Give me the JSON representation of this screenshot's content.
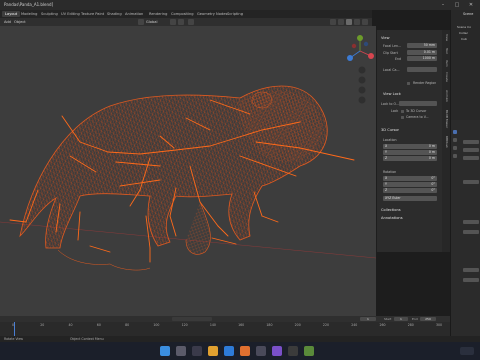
{
  "window": {
    "title": "Pandas\\Panda_A1.blend]"
  },
  "workspace_tabs": [
    {
      "label": "Layout",
      "active": true
    },
    {
      "label": "Modeling"
    },
    {
      "label": "Sculpting"
    },
    {
      "label": "UV Editing"
    },
    {
      "label": "Texture Paint"
    },
    {
      "label": "Shading"
    },
    {
      "label": "Animation"
    },
    {
      "label": "Rendering"
    },
    {
      "label": "Compositing"
    },
    {
      "label": "Geometry Nodes"
    },
    {
      "label": "Scripting"
    }
  ],
  "viewport_header": {
    "menu": [
      "Add",
      "Object"
    ],
    "orientation": "Global",
    "options_label": "Options"
  },
  "outliner": {
    "title": "Scene",
    "items": [
      "Scene Co",
      "Collec",
      "Cub"
    ]
  },
  "npanel": {
    "view_section": "View",
    "focal_length": {
      "label": "Focal Len...",
      "value": "50 mm"
    },
    "clip_start": {
      "label": "Clip Start",
      "value": "0.01 m"
    },
    "clip_end": {
      "label": "End",
      "value": "1000 m"
    },
    "local_camera": {
      "label": "Local Ca..."
    },
    "render_region": "Render Region",
    "view_lock": "View Lock",
    "lock_to_object": "Lock to O...",
    "lock_label": "Lock",
    "to_3d_cursor": "To 3D Cursor",
    "camera_to_view": "Camera to V...",
    "cursor_section": "3D Cursor",
    "location_label": "Location",
    "loc": [
      {
        "axis": "X",
        "value": "0 m"
      },
      {
        "axis": "Y",
        "value": "0 m"
      },
      {
        "axis": "Z",
        "value": "0 m"
      }
    ],
    "rotation_label": "Rotation",
    "rot": [
      {
        "axis": "X",
        "value": "0°"
      },
      {
        "axis": "Y",
        "value": "0°"
      },
      {
        "axis": "Z",
        "value": "0°"
      }
    ],
    "rotation_mode": "XYZ Euler",
    "collections": "Collections",
    "annotations": "Annotations"
  },
  "side_tabs": [
    "View",
    "Tool",
    "Item",
    "Create",
    "AnimLib",
    "BLOB Maker",
    "RBDLab"
  ],
  "timeline": {
    "ticks": [
      "0",
      "20",
      "40",
      "60",
      "80",
      "100",
      "120",
      "140",
      "160",
      "180",
      "200",
      "220",
      "240",
      "260",
      "280",
      "300"
    ],
    "current_frame": "1",
    "start_label": "Start",
    "start": "1",
    "end_label": "End",
    "end": "250"
  },
  "statusbar": {
    "left": "Rotate View",
    "middle": "Object Context Menu"
  },
  "colors": {
    "wireframe": "#e0521c",
    "bone": "#ff6a1a",
    "viewport_bg": "#3d3d3d"
  }
}
